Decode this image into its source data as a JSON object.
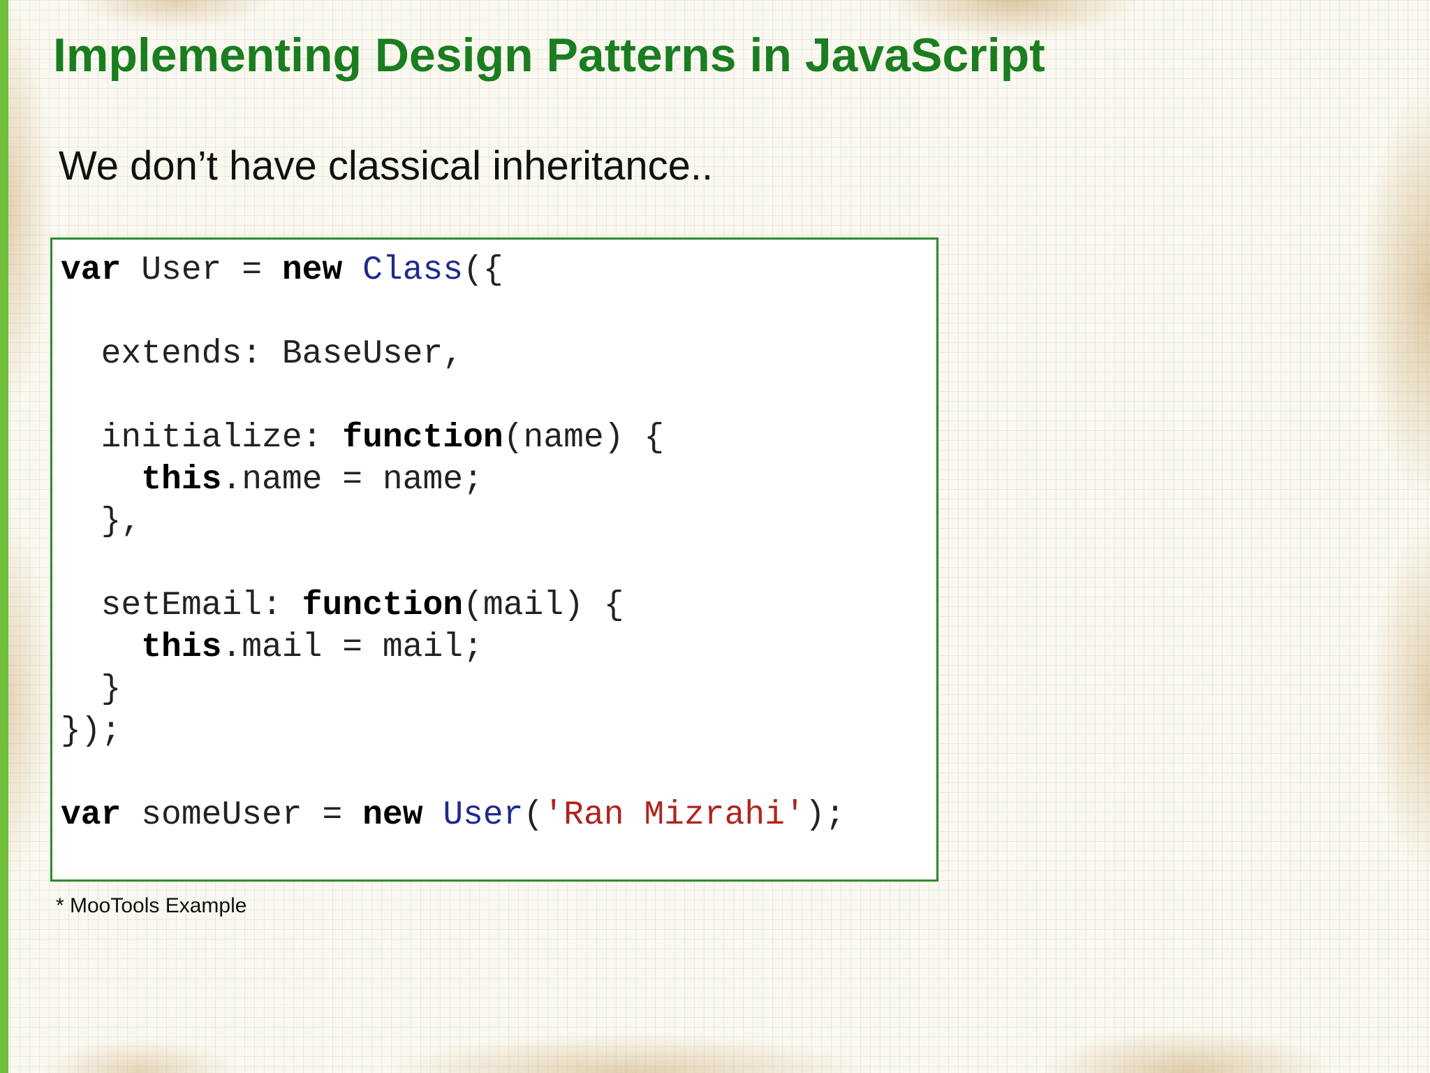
{
  "slide": {
    "title": "Implementing Design Patterns in JavaScript",
    "subtitle": "We don’t have classical inheritance..",
    "footnote": "* MooTools Example",
    "colors": {
      "title": "#1a7d20",
      "border": "#2e8b2e",
      "accent_bar": "#6fbf3a",
      "keyword": "#000000",
      "class_name": "#1f2a8c",
      "string": "#b0241e"
    }
  },
  "code": {
    "l1": {
      "kw1": "var",
      "t1": " User = ",
      "kw2": "new",
      "sp": " ",
      "cls": "Class",
      "t2": "({"
    },
    "l3": {
      "t1": "  extends: BaseUser,"
    },
    "l5": {
      "t1": "  initialize: ",
      "kw": "function",
      "t2": "(name) {"
    },
    "l6": {
      "indent": "    ",
      "kw": "this",
      "t1": ".name = name;"
    },
    "l7": {
      "t1": "  },"
    },
    "l9": {
      "t1": "  setEmail: ",
      "kw": "function",
      "t2": "(mail) {"
    },
    "l10": {
      "indent": "    ",
      "kw": "this",
      "t1": ".mail = mail;"
    },
    "l11": {
      "t1": "  }"
    },
    "l12": {
      "t1": "});"
    },
    "l14": {
      "kw1": "var",
      "t1": " someUser = ",
      "kw2": "new",
      "sp": " ",
      "cls": "User",
      "t2": "(",
      "str": "'Ran Mizrahi'",
      "t3": ");"
    }
  }
}
